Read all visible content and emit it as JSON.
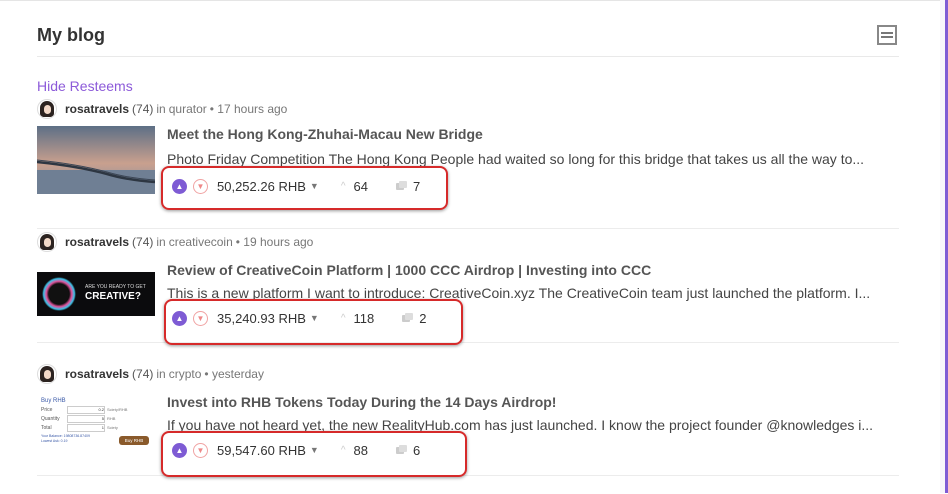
{
  "header": {
    "title": "My blog",
    "view_icon": "list-view-icon"
  },
  "hide_resteems": "Hide Resteems",
  "posts": [
    {
      "author": "rosatravels",
      "reputation": "(74)",
      "in_word": "in",
      "category": "qurator",
      "time": "• 17 hours ago",
      "title": "Meet the Hong Kong-Zhuhai-Macau New Bridge",
      "excerpt": "Photo Friday Competition The Hong Kong People had waited so long for this bridge that takes us all the way to...",
      "payout": "50,252.26 RHB",
      "voters": "64",
      "comments": "7",
      "thumb": "bridge-photo"
    },
    {
      "author": "rosatravels",
      "reputation": "(74)",
      "in_word": "in",
      "category": "creativecoin",
      "time": "• 19 hours ago",
      "title": "Review of CreativeCoin Platform | 1000 CCC Airdrop | Investing into CCC",
      "excerpt": "This is a new platform I want to introduce: CreativeCoin.xyz The CreativeCoin team just launched the platform. I...",
      "payout": "35,240.93 RHB",
      "voters": "118",
      "comments": "2",
      "thumb_text_small": "ARE YOU READY TO GET",
      "thumb_text_big": "CREATIVE?"
    },
    {
      "author": "rosatravels",
      "reputation": "(74)",
      "in_word": "in",
      "category": "crypto",
      "time": "• yesterday",
      "title": "Invest into RHB Tokens Today During the 14 Days Airdrop!",
      "excerpt": "If you have not heard yet, the new RealityHub.com has just launched. I know the project founder @knowledges i...",
      "payout": "59,547.60 RHB",
      "voters": "88",
      "comments": "6",
      "thumb_form": {
        "heading": "Buy RHB",
        "price_label": "Price",
        "price_value": "0.2",
        "price_unit": "Sciety/RHB",
        "quantity_label": "Quantity",
        "quantity_value": "5",
        "quantity_unit": "RHB",
        "total_label": "Total",
        "total_value": "1",
        "total_unit": "Sciety",
        "balance_text": "Your Balance: 19808736.87409",
        "note_text": "Lowest Ask: 0.19",
        "button": "Buy RHB"
      }
    }
  ],
  "colors": {
    "accent": "#7e5bd4",
    "highlight": "#d62a2a",
    "link": "#8c5ad9"
  }
}
